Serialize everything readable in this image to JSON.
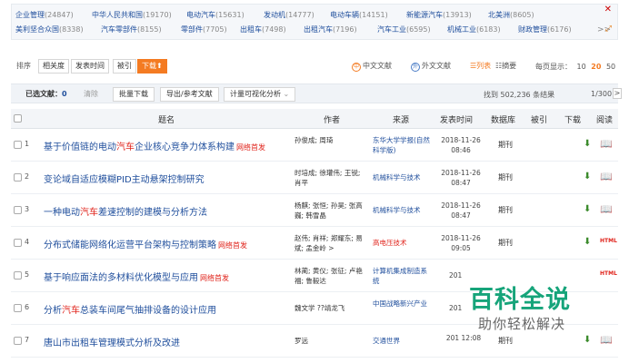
{
  "facets": {
    "row1": [
      {
        "name": "企业管理",
        "count": "(24847)"
      },
      {
        "name": "中华人民共和国",
        "count": "(19170)"
      },
      {
        "name": "电动汽车",
        "count": "(15631)"
      },
      {
        "name": "发动机",
        "count": "(14777)"
      },
      {
        "name": "电动车辆",
        "count": "(14151)"
      },
      {
        "name": "新能源汽车",
        "count": "(13913)"
      },
      {
        "name": "北美洲",
        "count": "(8605)"
      }
    ],
    "row2": [
      {
        "name": "美利坚合众国",
        "count": "(8338)"
      },
      {
        "name": "汽车零部件",
        "count": "(8155)"
      },
      {
        "name": "零部件",
        "count": "(7705)"
      },
      {
        "name": "出租车",
        "count": "(7498)"
      },
      {
        "name": "出租汽车",
        "count": "(7196)"
      },
      {
        "name": "汽车工业",
        "count": "(6595)"
      },
      {
        "name": "机械工业",
        "count": "(6183)"
      },
      {
        "name": "财政管理",
        "count": "(6176)"
      }
    ],
    "more": ">>"
  },
  "toolbar": {
    "sort_label": "排序",
    "sort_options": [
      "相关度",
      "发表时间",
      "被引",
      "下载"
    ],
    "active_sort": "下载",
    "lang_zh": "中文文献",
    "lang_en": "外文文献",
    "view_list": "列表",
    "view_abstract": "摘要",
    "page_size_label": "每页显示：",
    "page_sizes": [
      "10",
      "20",
      "50"
    ],
    "active_page_size": "20"
  },
  "selection": {
    "label": "已选文献：",
    "count": "0",
    "clear": "清除",
    "actions": [
      "批量下载",
      "导出/参考文献",
      "计量可视化分析"
    ],
    "found": "找到 502,236 条结果",
    "page": "1/300",
    "next": ">"
  },
  "table": {
    "headers": {
      "title": "题名",
      "author": "作者",
      "source": "来源",
      "date": "发表时间",
      "db": "数据库",
      "cited": "被引",
      "download": "下载",
      "read": "阅读"
    },
    "rows": [
      {
        "idx": "1",
        "title_pre": "基于价值链的电动",
        "kw": "汽车",
        "title_post": "企业核心竞争力体系构建",
        "tag": "网络首发",
        "author": "孙俊成; 周琦",
        "source": "东华大学学报(自然科学版)",
        "date": "2018-11-26 08:46",
        "db": "期刊",
        "read": "book"
      },
      {
        "idx": "2",
        "title_pre": "变论域自适应模糊PID主动悬架控制研究",
        "kw": "",
        "title_post": "",
        "tag": "",
        "author": "时培成; 徐瓘伟; 王锐; 肖平",
        "source": "机械科学与技术",
        "date": "2018-11-26 08:47",
        "db": "期刊",
        "read": "book"
      },
      {
        "idx": "3",
        "title_pre": "一种电动",
        "kw": "汽车",
        "title_post": "差速控制的建模与分析方法",
        "tag": "",
        "author": "杨麒; 张恒; 孙昊; 张高巍; 韩雪晶",
        "source": "机械科学与技术",
        "date": "2018-11-26 08:47",
        "db": "期刊",
        "read": "book"
      },
      {
        "idx": "4",
        "title_pre": "分布式储能网络化运营平台架构与控制策略",
        "kw": "",
        "title_post": "",
        "tag": "网络首发",
        "author": "赵伟; 肖祥; 郑耀东; 易斌; 孟金岭 >",
        "source": "高电压技术",
        "date": "2018-11-26 09:05",
        "db": "期刊",
        "read": "html"
      },
      {
        "idx": "5",
        "title_pre": "基于响应面法的多材料优化模型与应用",
        "kw": "",
        "title_post": "",
        "tag": "网络首发",
        "author": "林蔺; 黄仪; 张征; 卢艳福; 鲁毅达",
        "source": "计算机集成制造系统",
        "date": "201",
        "db": "",
        "read": "html"
      },
      {
        "idx": "6",
        "title_pre": "分析",
        "kw": "汽车",
        "title_post": "总装车间尾气抽排设备的设计应用",
        "tag": "",
        "author": "魏文学 ??靖龙飞",
        "source": "中国战略新兴产业",
        "date": "201",
        "db": "",
        "read": "book"
      },
      {
        "idx": "7",
        "title_pre": "唐山市出租车管理模式分析及改进",
        "kw": "",
        "title_post": "",
        "tag": "",
        "author": "罗远",
        "source": "交通世界",
        "date": "201 12:08",
        "db": "期刊",
        "read": "book"
      }
    ]
  },
  "watermark": {
    "title": "百科全说",
    "subtitle": "助你轻松解决"
  },
  "icons": {
    "close": "close-icon",
    "pin": "pin-icon",
    "download": "download-icon",
    "read": "book-icon"
  },
  "colors": {
    "link": "#1f4e9c",
    "accent": "#f47b22",
    "keyword": "#e0231b",
    "green": "#3a8a2a",
    "watermark": "#16a47a"
  }
}
